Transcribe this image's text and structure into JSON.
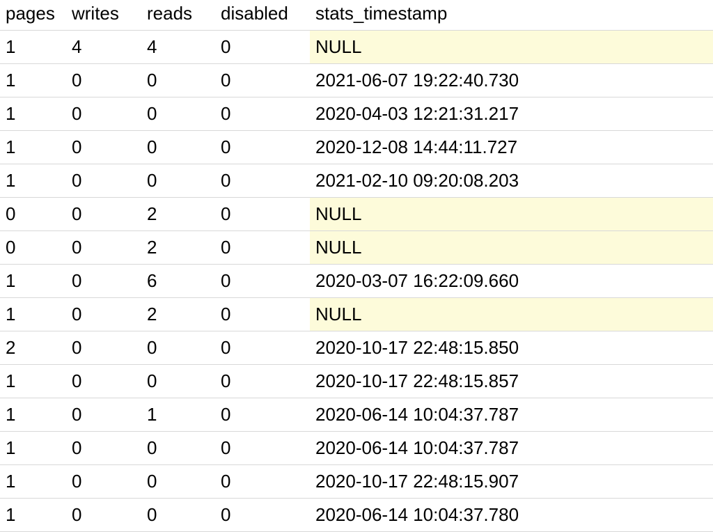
{
  "columns": {
    "pages": "pages",
    "writes": "writes",
    "reads": "reads",
    "disabled": "disabled",
    "stats_timestamp": "stats_timestamp"
  },
  "rows": [
    {
      "pages": "1",
      "writes": "4",
      "reads": "4",
      "disabled": "0",
      "stats_timestamp": "NULL",
      "ts_null": true
    },
    {
      "pages": "1",
      "writes": "0",
      "reads": "0",
      "disabled": "0",
      "stats_timestamp": "2021-06-07 19:22:40.730",
      "ts_null": false
    },
    {
      "pages": "1",
      "writes": "0",
      "reads": "0",
      "disabled": "0",
      "stats_timestamp": "2020-04-03 12:21:31.217",
      "ts_null": false
    },
    {
      "pages": "1",
      "writes": "0",
      "reads": "0",
      "disabled": "0",
      "stats_timestamp": "2020-12-08 14:44:11.727",
      "ts_null": false
    },
    {
      "pages": "1",
      "writes": "0",
      "reads": "0",
      "disabled": "0",
      "stats_timestamp": "2021-02-10 09:20:08.203",
      "ts_null": false
    },
    {
      "pages": "0",
      "writes": "0",
      "reads": "2",
      "disabled": "0",
      "stats_timestamp": "NULL",
      "ts_null": true
    },
    {
      "pages": "0",
      "writes": "0",
      "reads": "2",
      "disabled": "0",
      "stats_timestamp": "NULL",
      "ts_null": true
    },
    {
      "pages": "1",
      "writes": "0",
      "reads": "6",
      "disabled": "0",
      "stats_timestamp": "2020-03-07 16:22:09.660",
      "ts_null": false
    },
    {
      "pages": "1",
      "writes": "0",
      "reads": "2",
      "disabled": "0",
      "stats_timestamp": "NULL",
      "ts_null": true
    },
    {
      "pages": "2",
      "writes": "0",
      "reads": "0",
      "disabled": "0",
      "stats_timestamp": "2020-10-17 22:48:15.850",
      "ts_null": false
    },
    {
      "pages": "1",
      "writes": "0",
      "reads": "0",
      "disabled": "0",
      "stats_timestamp": "2020-10-17 22:48:15.857",
      "ts_null": false
    },
    {
      "pages": "1",
      "writes": "0",
      "reads": "1",
      "disabled": "0",
      "stats_timestamp": "2020-06-14 10:04:37.787",
      "ts_null": false
    },
    {
      "pages": "1",
      "writes": "0",
      "reads": "0",
      "disabled": "0",
      "stats_timestamp": "2020-06-14 10:04:37.787",
      "ts_null": false
    },
    {
      "pages": "1",
      "writes": "0",
      "reads": "0",
      "disabled": "0",
      "stats_timestamp": "2020-10-17 22:48:15.907",
      "ts_null": false
    },
    {
      "pages": "1",
      "writes": "0",
      "reads": "0",
      "disabled": "0",
      "stats_timestamp": "2020-06-14 10:04:37.780",
      "ts_null": false
    }
  ]
}
